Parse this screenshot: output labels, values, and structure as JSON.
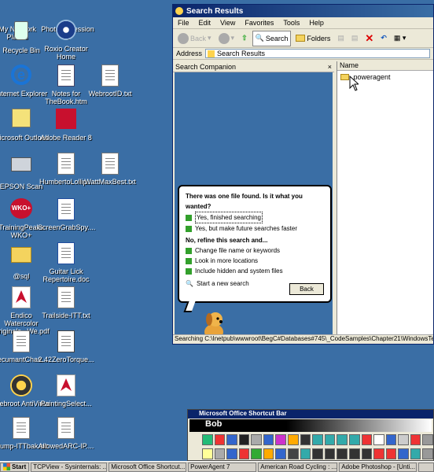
{
  "desktop": {
    "icons": [
      {
        "label": "My Network Places",
        "icon": "network-places-icon"
      },
      {
        "label": "PhotoImpression 5",
        "icon": "photoimpression-icon"
      },
      {
        "label": "Recycle Bin",
        "icon": "recycle-bin-icon"
      },
      {
        "label": "Roxio Creator Home",
        "icon": "roxio-icon"
      },
      {
        "label": "Internet Explorer",
        "icon": "internet-explorer-icon"
      },
      {
        "label": "Notes for TheBook.htm",
        "icon": "web-page-icon"
      },
      {
        "label": "WebrootID.txt",
        "icon": "text-file-icon"
      },
      {
        "label": "Microsoft Outlook",
        "icon": "outlook-icon"
      },
      {
        "label": "Adobe Reader 8",
        "icon": "adobe-reader-icon"
      },
      {
        "label": "EPSON Scan",
        "icon": "scanner-icon"
      },
      {
        "label": "HumbertoLollip...",
        "icon": "text-file-icon"
      },
      {
        "label": "WattMaxBest.txt",
        "icon": "text-file-icon"
      },
      {
        "label": "TrainingPeaks WKO+",
        "icon": "wko-icon"
      },
      {
        "label": "ScreenGrabSpy....",
        "icon": "word-doc-icon"
      },
      {
        "label": "@sql",
        "icon": "folder-icon"
      },
      {
        "label": "Guitar Lick Repertoire.doc",
        "icon": "word-doc-icon"
      },
      {
        "label": "Endico Watercolor Originals _We.pdf",
        "icon": "pdf-icon"
      },
      {
        "label": "Trailside-ITT.txt",
        "icon": "text-file-icon"
      },
      {
        "label": "recumantChas...",
        "icon": "text-file-icon"
      },
      {
        "label": "2.42ZeroTorque...",
        "icon": "movie-icon"
      },
      {
        "label": "Webroot AntiVirus",
        "icon": "webroot-icon"
      },
      {
        "label": "PaintingSelect...",
        "icon": "pdf-icon"
      },
      {
        "label": "Hump-ITTbak.txt",
        "icon": "text-file-icon"
      },
      {
        "label": "AllowedARC-IP....",
        "icon": "text-file-icon"
      }
    ]
  },
  "window": {
    "title": "Search Results",
    "menu": [
      "File",
      "Edit",
      "View",
      "Favorites",
      "Tools",
      "Help"
    ],
    "toolbar": {
      "back": "Back",
      "search": "Search",
      "folders": "Folders"
    },
    "address_label": "Address",
    "address_value": "Search Results",
    "pane_title": "Search Companion",
    "bubble": {
      "question": "There was one file found.  Is it what you wanted?",
      "yes1": "Yes, finished searching",
      "yes2": "Yes, but make future searches faster",
      "refine": "No, refine this search and...",
      "opt1": "Change file name or keywords",
      "opt2": "Look in more locations",
      "opt3": "Include hidden and system files",
      "new_search": "Start a new search",
      "back": "Back"
    },
    "column_name": "Name",
    "file": ".poweragent",
    "status": "Searching C:\\Inetpub\\wwwroot\\BegC#Databases#745\\_CodeSamples\\Chapter21\\WindowsTerraClient\\obj\\De"
  },
  "shortcut_bar": {
    "title": "Microsoft Office Shortcut Bar",
    "name": "Bob"
  },
  "taskbar": {
    "start": "Start",
    "items": [
      "TCPView - Sysinternals: ...",
      "Microsoft Office Shortcut...",
      "PowerAgent 7",
      "American Road Cycling : ...",
      "Adobe Photoshop - [Unti...",
      ""
    ]
  },
  "colors": {
    "desktop": "#3a6ea5",
    "title": "#0a246a",
    "accent_green": "#33a02c"
  }
}
